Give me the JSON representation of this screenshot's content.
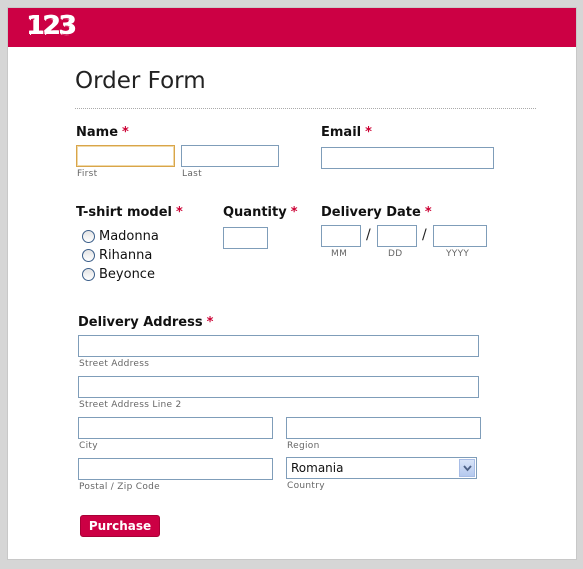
{
  "header": {
    "logo_text": "123",
    "brand_color": "#cc0044"
  },
  "form": {
    "title": "Order Form",
    "required_mark": "*",
    "name": {
      "label": "Name",
      "first_sub": "First",
      "last_sub": "Last",
      "first_value": "",
      "last_value": ""
    },
    "email": {
      "label": "Email",
      "value": ""
    },
    "tshirt": {
      "label": "T-shirt model",
      "options": [
        "Madonna",
        "Rihanna",
        "Beyonce"
      ]
    },
    "quantity": {
      "label": "Quantity",
      "value": ""
    },
    "delivery_date": {
      "label": "Delivery Date",
      "mm_sub": "MM",
      "dd_sub": "DD",
      "yyyy_sub": "YYYY",
      "separator": "/"
    },
    "address": {
      "label": "Delivery Address",
      "street_sub": "Street Address",
      "street2_sub": "Street Address Line 2",
      "city_sub": "City",
      "region_sub": "Region",
      "postal_sub": "Postal / Zip Code",
      "country_sub": "Country",
      "country_value": "Romania"
    },
    "purchase_label": "Purchase"
  }
}
